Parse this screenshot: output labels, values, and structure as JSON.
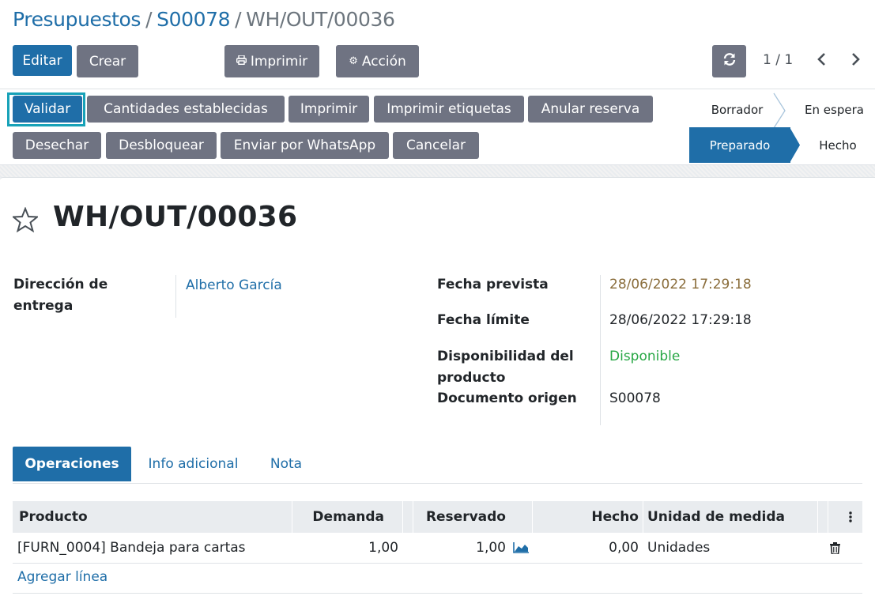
{
  "breadcrumb": {
    "item1": "Presupuestos",
    "item2": "S00078",
    "current": "WH/OUT/00036",
    "sep": "/"
  },
  "toolbar": {
    "edit": "Editar",
    "create": "Crear",
    "print": "Imprimir",
    "action": "Acción"
  },
  "pager": {
    "value": "1 / 1"
  },
  "actions_row1": [
    "Validar",
    "Cantidades establecidas",
    "Imprimir",
    "Imprimir etiquetas",
    "Anular reserva"
  ],
  "actions_row2": [
    "Desechar",
    "Desbloquear",
    "Enviar por WhatsApp",
    "Cancelar"
  ],
  "stages": {
    "draft": "Borrador",
    "waiting": "En espera",
    "ready": "Preparado",
    "done": "Hecho"
  },
  "record": {
    "title": "WH/OUT/00036"
  },
  "fields": {
    "delivery_address_label": "Dirección de entrega",
    "delivery_address_value": "Alberto García",
    "scheduled_date_label": "Fecha prevista",
    "scheduled_date_value": "28/06/2022 17:29:18",
    "deadline_label": "Fecha límite",
    "deadline_value": "28/06/2022 17:29:18",
    "availability_label": "Disponibilidad del producto",
    "availability_value": "Disponible",
    "origin_label": "Documento origen",
    "origin_value": "S00078"
  },
  "tabs": [
    "Operaciones",
    "Info adicional",
    "Nota"
  ],
  "table": {
    "headers": [
      "Producto",
      "Demanda",
      "Reservado",
      "Hecho",
      "Unidad de medida"
    ],
    "rows": [
      {
        "product": "[FURN_0004] Bandeja para cartas",
        "demand": "1,00",
        "reserved": "1,00",
        "done": "0,00",
        "uom": "Unidades"
      }
    ],
    "add_line": "Agregar línea"
  },
  "colors": {
    "primary": "#1f6ea8",
    "secondary": "#6f7382",
    "scheduled_date": "#8a6d3b",
    "available": "#28a745",
    "highlight": "#17a2b8"
  }
}
